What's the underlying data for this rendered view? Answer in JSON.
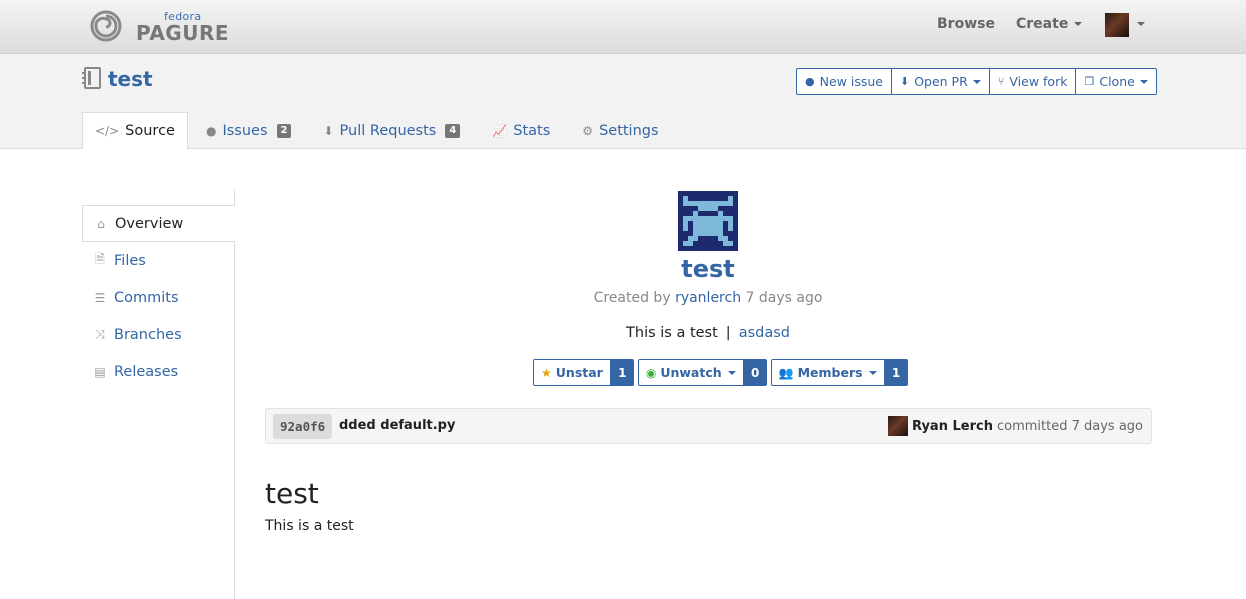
{
  "brand": {
    "fedora": "fedora",
    "pagure": "PAGURE"
  },
  "topnav": {
    "browse": "Browse",
    "create": "Create"
  },
  "repo": {
    "name": "test"
  },
  "actions": {
    "new_issue": "New issue",
    "open_pr": "Open PR",
    "view_fork": "View fork",
    "clone": "Clone"
  },
  "tabs": {
    "source": "Source",
    "issues": {
      "label": "Issues",
      "count": "2"
    },
    "pull_requests": {
      "label": "Pull Requests",
      "count": "4"
    },
    "stats": "Stats",
    "settings": "Settings"
  },
  "sidebar": [
    "Overview",
    "Files",
    "Commits",
    "Branches",
    "Releases"
  ],
  "project": {
    "name": "test",
    "created_by_prefix": "Created by",
    "creator": "ryanlerch",
    "created_ago": "7 days ago",
    "description": "This is a test",
    "separator": "|",
    "link": "asdasd"
  },
  "stats": {
    "unstar": {
      "label": "Unstar",
      "count": "1"
    },
    "unwatch": {
      "label": "Unwatch",
      "count": "0"
    },
    "members": {
      "label": "Members",
      "count": "1"
    }
  },
  "last_commit": {
    "hash": "92a0f6",
    "message": "dded default.py",
    "author": "Ryan Lerch",
    "verb": "committed",
    "ago": "7 days ago"
  },
  "readme": {
    "title": "test",
    "body": "This is a test"
  },
  "colors": {
    "link": "#3465a4",
    "badge": "#777777",
    "avatar_bg": "#1e2a6e",
    "avatar_fg": "#7fb9d9"
  }
}
